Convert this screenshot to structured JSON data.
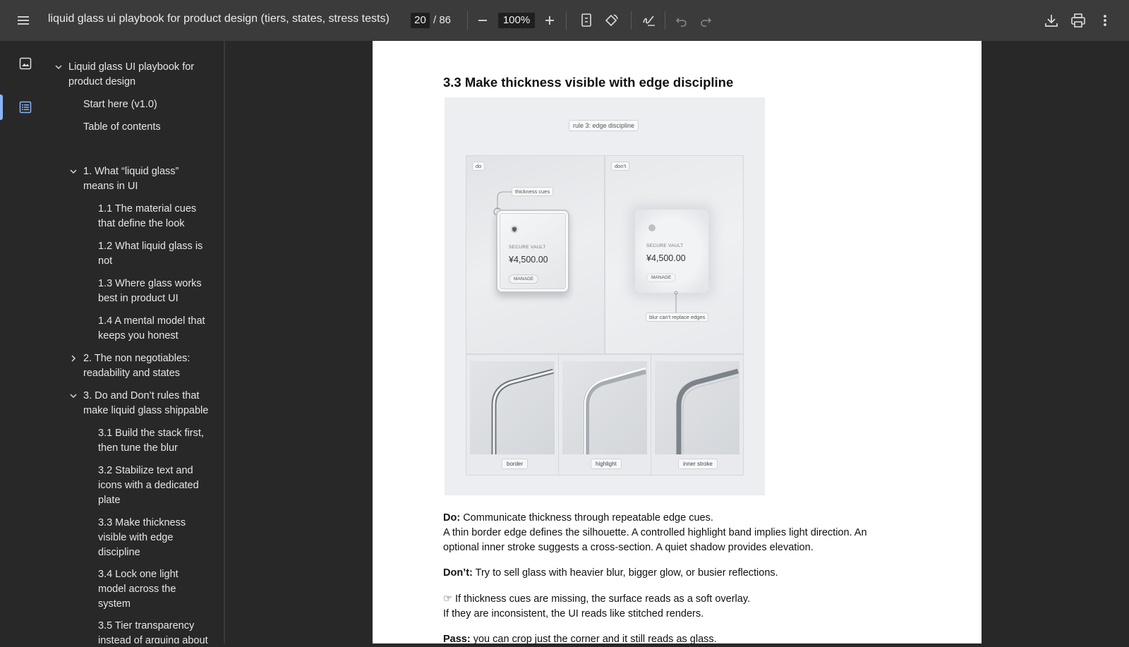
{
  "toolbar": {
    "title": "liquid glass ui playbook for product design (tiers, states, stress tests)",
    "page_current": "20",
    "page_total": "/ 86",
    "zoom": "100%"
  },
  "outline": {
    "items": [
      {
        "label_1": "Liquid glass UI playbook for",
        "label_2": "product design"
      },
      {
        "label": "Start here (v1.0)"
      },
      {
        "label": "Table of contents"
      },
      {
        "label_1": "1. What “liquid glass”",
        "label_2": "means in UI"
      },
      {
        "label_1": "1.1 The material cues",
        "label_2": "that define the look"
      },
      {
        "label_1": "1.2 What liquid glass is",
        "label_2": "not"
      },
      {
        "label_1": "1.3 Where glass works",
        "label_2": "best in product UI"
      },
      {
        "label_1": "1.4 A mental model that",
        "label_2": "keeps you honest"
      },
      {
        "label_1": "2. The non negotiables:",
        "label_2": "readability and states"
      },
      {
        "label_1": "3. Do and Don’t rules that",
        "label_2": "make liquid glass shippable"
      },
      {
        "label_1": "3.1 Build the stack first,",
        "label_2": "then tune the blur"
      },
      {
        "label_1": "3.2 Stabilize text and",
        "label_2": "icons with a dedicated",
        "label_3": "plate"
      },
      {
        "label_1": "3.3 Make thickness",
        "label_2": "visible with edge",
        "label_3": "discipline"
      },
      {
        "label_1": "3.4 Lock one light",
        "label_2": "model across the",
        "label_3": "system"
      },
      {
        "label_1": "3.5 Tier transparency",
        "label_2": "instead of arguing about"
      }
    ]
  },
  "page": {
    "heading": "3.3 Make thickness visible with edge discipline",
    "figure": {
      "rule_label": "rule 3: edge discipline",
      "do_label": "do",
      "dont_label": "don’t",
      "thickness_cues": "thickness cues",
      "vault_label": "SECURE VAULT",
      "amount": "¥4,500.00",
      "manage": "MANAGE",
      "blur_note": "blur can't replace edges",
      "tiles": [
        "border",
        "highlight",
        "inner stroke"
      ]
    },
    "do_prefix": "Do:",
    "do_text": " Communicate thickness through repeatable edge cues.",
    "do_body_1": "A thin border edge defines the silhouette. A controlled highlight band implies light direction. An",
    "do_body_2": "optional inner stroke suggests a cross-section. A quiet shadow provides elevation.",
    "dont_prefix": "Don’t:",
    "dont_text": " Try to sell glass with heavier blur, bigger glow, or busier reflections.",
    "if_1": "☞ If thickness cues are missing, the surface reads as a soft overlay.",
    "if_2": "If they are inconsistent, the UI reads like stitched renders.",
    "pass_prefix": "Pass:",
    "pass_text": " you can crop just the corner and it still reads as glass."
  },
  "colors": {
    "toolbar_bg": "#3b3b3b",
    "sidebar_bg": "#282828",
    "accent": "#8ab4f8"
  }
}
